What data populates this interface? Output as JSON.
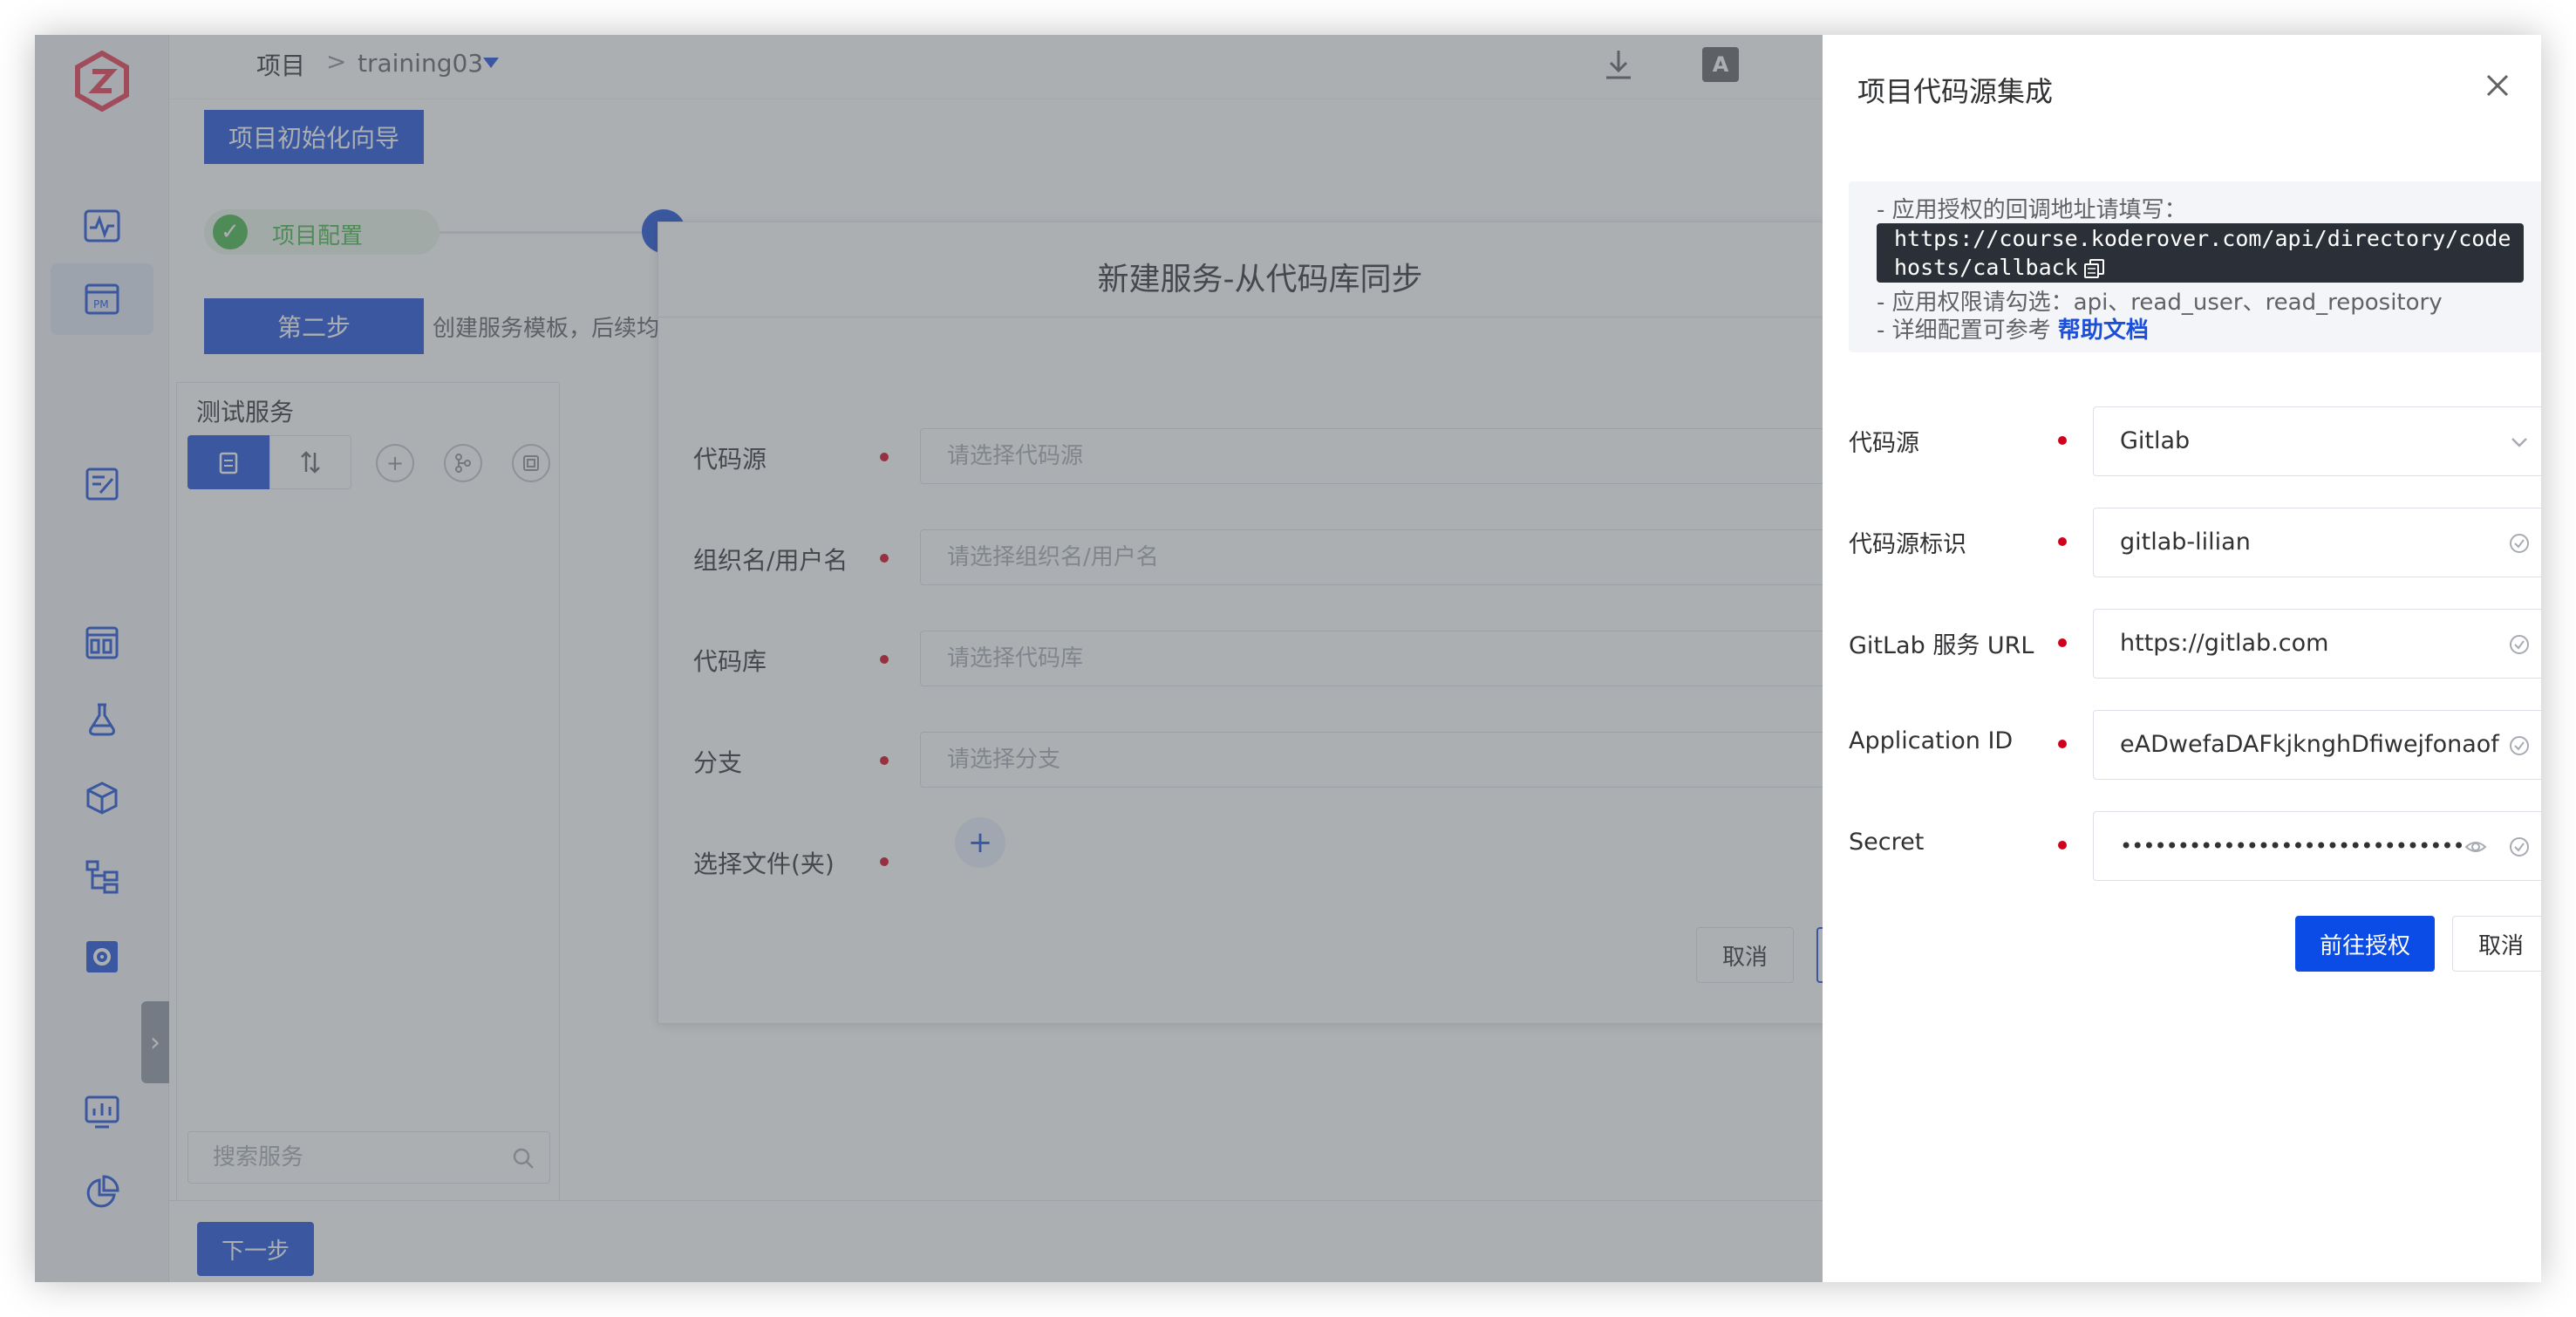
{
  "header": {
    "breadcrumb_root": "项目",
    "breadcrumb_sep": ">",
    "project_name": "training03"
  },
  "main": {
    "guide_button": "项目初始化向导",
    "step1_label": "项目配置",
    "step2_button": "第二步",
    "step2_desc": "创建服务模板，后续均",
    "service_panel_title": "测试服务",
    "service_search_placeholder": "搜索服务",
    "next_button": "下一步"
  },
  "dialog": {
    "title": "新建服务-从代码库同步",
    "fields": [
      {
        "label": "代码源",
        "placeholder": "请选择代码源"
      },
      {
        "label": "组织名/用户名",
        "placeholder": "请选择组织名/用户名"
      },
      {
        "label": "代码库",
        "placeholder": "请选择代码库"
      },
      {
        "label": "分支",
        "placeholder": "请选择分支"
      },
      {
        "label": "选择文件(夹)",
        "placeholder": ""
      }
    ],
    "cancel_button": "取消"
  },
  "drawer": {
    "title": "项目代码源集成",
    "info": {
      "callback_intro": "- 应用授权的回调地址请填写：",
      "callback_url": "https://course.koderover.com/api/directory/codehosts/callback",
      "permissions": "- 应用权限请勾选：api、read_user、read_repository",
      "help_prefix": "- 详细配置可参考",
      "help_link": "帮助文档"
    },
    "form": {
      "source_label": "代码源",
      "source_value": "Gitlab",
      "alias_label": "代码源标识",
      "alias_value": "gitlab-lilian",
      "url_label": "GitLab 服务 URL",
      "url_value": "https://gitlab.com",
      "appid_label": "Application ID",
      "appid_value": "eADwefaDAFkjknghDfiwejfonaof",
      "secret_label": "Secret",
      "secret_value": "••••••••••••••••••••••••••••••"
    },
    "authorize_button": "前往授权",
    "cancel_button": "取消"
  },
  "colors": {
    "primary": "#1b4fd8",
    "success": "#45b649",
    "required": "#d0021b"
  }
}
